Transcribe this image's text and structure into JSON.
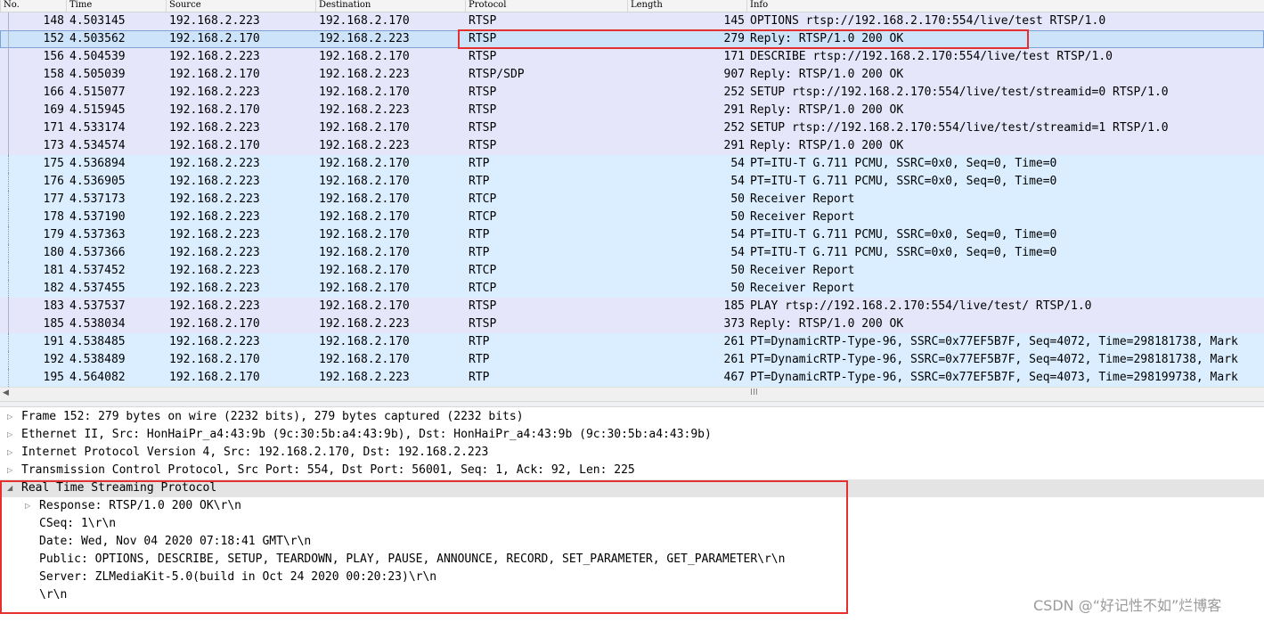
{
  "columns": {
    "no": "No.",
    "time": "Time",
    "source": "Source",
    "destination": "Destination",
    "protocol": "Protocol",
    "length": "Length",
    "info": "Info"
  },
  "packets": [
    {
      "no": "148",
      "time": "4.503145",
      "src": "192.168.2.223",
      "dst": "192.168.2.170",
      "proto": "RTSP",
      "len": "145",
      "info": "OPTIONS rtsp://192.168.2.170:554/live/test RTSP/1.0"
    },
    {
      "no": "152",
      "time": "4.503562",
      "src": "192.168.2.170",
      "dst": "192.168.2.223",
      "proto": "RTSP",
      "len": "279",
      "info": "Reply: RTSP/1.0 200 OK"
    },
    {
      "no": "156",
      "time": "4.504539",
      "src": "192.168.2.223",
      "dst": "192.168.2.170",
      "proto": "RTSP",
      "len": "171",
      "info": "DESCRIBE rtsp://192.168.2.170:554/live/test RTSP/1.0"
    },
    {
      "no": "158",
      "time": "4.505039",
      "src": "192.168.2.170",
      "dst": "192.168.2.223",
      "proto": "RTSP/SDP",
      "len": "907",
      "info": "Reply: RTSP/1.0 200 OK"
    },
    {
      "no": "166",
      "time": "4.515077",
      "src": "192.168.2.223",
      "dst": "192.168.2.170",
      "proto": "RTSP",
      "len": "252",
      "info": "SETUP rtsp://192.168.2.170:554/live/test/streamid=0 RTSP/1.0"
    },
    {
      "no": "169",
      "time": "4.515945",
      "src": "192.168.2.170",
      "dst": "192.168.2.223",
      "proto": "RTSP",
      "len": "291",
      "info": "Reply: RTSP/1.0 200 OK"
    },
    {
      "no": "171",
      "time": "4.533174",
      "src": "192.168.2.223",
      "dst": "192.168.2.170",
      "proto": "RTSP",
      "len": "252",
      "info": "SETUP rtsp://192.168.2.170:554/live/test/streamid=1 RTSP/1.0"
    },
    {
      "no": "173",
      "time": "4.534574",
      "src": "192.168.2.170",
      "dst": "192.168.2.223",
      "proto": "RTSP",
      "len": "291",
      "info": "Reply: RTSP/1.0 200 OK"
    },
    {
      "no": "175",
      "time": "4.536894",
      "src": "192.168.2.223",
      "dst": "192.168.2.170",
      "proto": "RTP",
      "len": "54",
      "info": "PT=ITU-T G.711 PCMU, SSRC=0x0, Seq=0, Time=0"
    },
    {
      "no": "176",
      "time": "4.536905",
      "src": "192.168.2.223",
      "dst": "192.168.2.170",
      "proto": "RTP",
      "len": "54",
      "info": "PT=ITU-T G.711 PCMU, SSRC=0x0, Seq=0, Time=0"
    },
    {
      "no": "177",
      "time": "4.537173",
      "src": "192.168.2.223",
      "dst": "192.168.2.170",
      "proto": "RTCP",
      "len": "50",
      "info": "Receiver Report"
    },
    {
      "no": "178",
      "time": "4.537190",
      "src": "192.168.2.223",
      "dst": "192.168.2.170",
      "proto": "RTCP",
      "len": "50",
      "info": "Receiver Report"
    },
    {
      "no": "179",
      "time": "4.537363",
      "src": "192.168.2.223",
      "dst": "192.168.2.170",
      "proto": "RTP",
      "len": "54",
      "info": "PT=ITU-T G.711 PCMU, SSRC=0x0, Seq=0, Time=0"
    },
    {
      "no": "180",
      "time": "4.537366",
      "src": "192.168.2.223",
      "dst": "192.168.2.170",
      "proto": "RTP",
      "len": "54",
      "info": "PT=ITU-T G.711 PCMU, SSRC=0x0, Seq=0, Time=0"
    },
    {
      "no": "181",
      "time": "4.537452",
      "src": "192.168.2.223",
      "dst": "192.168.2.170",
      "proto": "RTCP",
      "len": "50",
      "info": "Receiver Report"
    },
    {
      "no": "182",
      "time": "4.537455",
      "src": "192.168.2.223",
      "dst": "192.168.2.170",
      "proto": "RTCP",
      "len": "50",
      "info": "Receiver Report"
    },
    {
      "no": "183",
      "time": "4.537537",
      "src": "192.168.2.223",
      "dst": "192.168.2.170",
      "proto": "RTSP",
      "len": "185",
      "info": "PLAY rtsp://192.168.2.170:554/live/test/ RTSP/1.0"
    },
    {
      "no": "185",
      "time": "4.538034",
      "src": "192.168.2.170",
      "dst": "192.168.2.223",
      "proto": "RTSP",
      "len": "373",
      "info": "Reply: RTSP/1.0 200 OK"
    },
    {
      "no": "191",
      "time": "4.538485",
      "src": "192.168.2.223",
      "dst": "192.168.2.170",
      "proto": "RTP",
      "len": "261",
      "info": "PT=DynamicRTP-Type-96, SSRC=0x77EF5B7F, Seq=4072, Time=298181738, Mark"
    },
    {
      "no": "192",
      "time": "4.538489",
      "src": "192.168.2.170",
      "dst": "192.168.2.170",
      "proto": "RTP",
      "len": "261",
      "info": "PT=DynamicRTP-Type-96, SSRC=0x77EF5B7F, Seq=4072, Time=298181738, Mark"
    },
    {
      "no": "195",
      "time": "4.564082",
      "src": "192.168.2.170",
      "dst": "192.168.2.223",
      "proto": "RTP",
      "len": "467",
      "info": "PT=DynamicRTP-Type-96, SSRC=0x77EF5B7F, Seq=4073, Time=298199738, Mark"
    }
  ],
  "details": [
    "Frame 152: 279 bytes on wire (2232 bits), 279 bytes captured (2232 bits)",
    "Ethernet II, Src: HonHaiPr_a4:43:9b (9c:30:5b:a4:43:9b), Dst: HonHaiPr_a4:43:9b (9c:30:5b:a4:43:9b)",
    "Internet Protocol Version 4, Src: 192.168.2.170, Dst: 192.168.2.223",
    "Transmission Control Protocol, Src Port: 554, Dst Port: 56001, Seq: 1, Ack: 92, Len: 225",
    "Real Time Streaming Protocol",
    "Response: RTSP/1.0 200 OK\\r\\n",
    "CSeq: 1\\r\\n",
    "Date: Wed, Nov 04 2020 07:18:41 GMT\\r\\n",
    "Public: OPTIONS, DESCRIBE, SETUP, TEARDOWN, PLAY, PAUSE, ANNOUNCE, RECORD, SET_PARAMETER, GET_PARAMETER\\r\\n",
    "Server: ZLMediaKit-5.0(build in Oct 24 2020 00:20:23)\\r\\n",
    "\\r\\n"
  ],
  "icons": {
    "expand": "triangle-right",
    "collapse": "triangle-down",
    "scroll_left": "triangle-left",
    "scroll_grip": "grip"
  },
  "glyphs": {
    "expand": "▷",
    "collapse": "◢",
    "scroll_left": "◀",
    "scroll_grip": "III"
  },
  "colors": {
    "rtsp_row": "#e6e6fa",
    "rtp_row": "#daeeff",
    "selected_row": "#cde3fa",
    "annotation_box": "#e4312f"
  },
  "watermark": "CSDN @“好记性不如”烂博客"
}
